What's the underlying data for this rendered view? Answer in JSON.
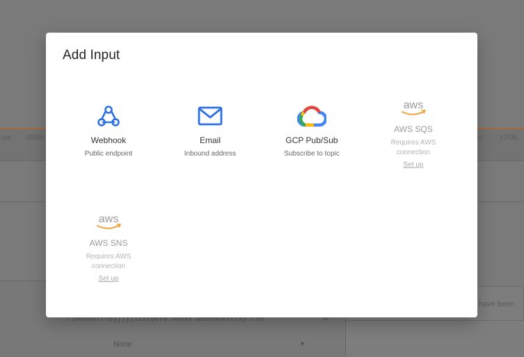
{
  "background": {
    "ticks": [
      "um",
      "05/06",
      "um",
      "17/06"
    ],
    "input_hint": "have been",
    "mono_text": "r1m6b94fcr8jjjjj1zzc86r0.hooks.webhookrelay.com",
    "select_value": "None"
  },
  "modal": {
    "title": "Add Input",
    "tiles": [
      {
        "name": "Webhook",
        "desc": "Public endpoint",
        "icon": "webhook-icon"
      },
      {
        "name": "Email",
        "desc": "Inbound address",
        "icon": "email-icon"
      },
      {
        "name": "GCP Pub/Sub",
        "desc": "Subscribe to topic",
        "icon": "gcp-icon"
      },
      {
        "name": "AWS SQS",
        "desc": "Requires AWS connection",
        "setup": "Set up",
        "icon": "aws-icon"
      },
      {
        "name": "AWS SNS",
        "desc": "Requires AWS connection",
        "setup": "Set up",
        "icon": "aws-icon"
      }
    ]
  },
  "colors": {
    "accent": "#2f6fe4",
    "aws_orange": "#f2a23a",
    "overlay": "#7a7a7a"
  }
}
